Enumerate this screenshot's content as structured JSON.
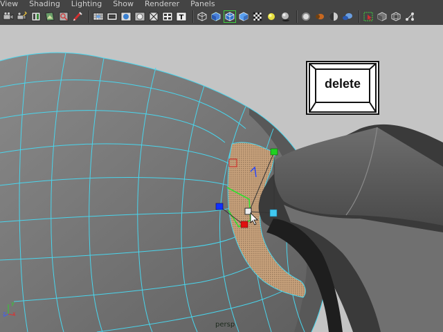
{
  "menubar": {
    "items": [
      "View",
      "Shading",
      "Lighting",
      "Show",
      "Renderer",
      "Panels"
    ]
  },
  "toolbar": {
    "icons": [
      "select-camera-icon",
      "lock-camera-icon",
      "bookmark-icon",
      "image-plane-icon",
      "two-d-pan-zoom-icon",
      "grease-pencil-icon",
      "grid-icon",
      "film-gate-icon",
      "resolution-gate-icon",
      "gate-mask-icon",
      "field-chart-icon",
      "safe-action-icon",
      "safe-title-icon",
      "wireframe-icon",
      "smooth-shade-icon",
      "wireframe-on-shaded-icon",
      "default-material-icon",
      "textured-icon",
      "use-all-lights-icon",
      "shadows-icon",
      "screen-space-ao-icon",
      "motion-blur-icon",
      "multisample-aa-icon",
      "depth-of-field-icon",
      "isolate-select-icon",
      "xray-icon",
      "xray-active-components-icon",
      "xray-joints-icon"
    ]
  },
  "viewport": {
    "camera_label": "persp",
    "overlay_key_label": "delete",
    "axis": {
      "x": "x",
      "y": "y",
      "z": "z"
    },
    "colors": {
      "background": "#c4c4c4",
      "wire": "#49d6ee",
      "mesh": "#7a7a7a",
      "selected_face": "#c8a27c",
      "handle_x": "#e01010",
      "handle_y": "#20d020",
      "handle_z": "#1030ff",
      "handle_center": "#40c8f0"
    }
  }
}
